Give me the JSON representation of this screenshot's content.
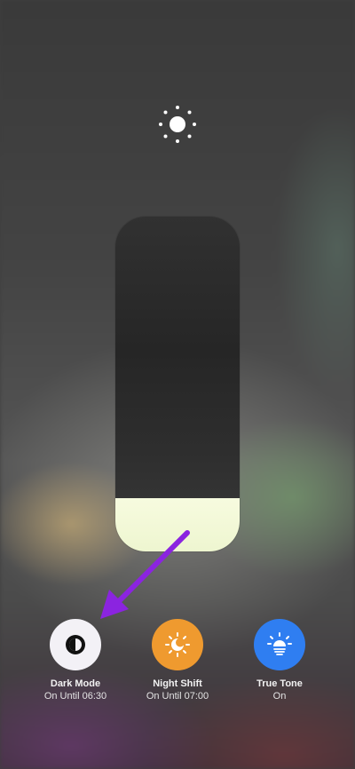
{
  "brightness": {
    "level": 0.16,
    "icon": "sun-icon"
  },
  "controls": [
    {
      "label": "Dark Mode",
      "status": "On Until 06:30",
      "icon": "dark-mode-icon",
      "color": "#f3f1f6"
    },
    {
      "label": "Night Shift",
      "status": "On Until 07:00",
      "icon": "night-shift-icon",
      "color": "#ef9a2f"
    },
    {
      "label": "True Tone",
      "status": "On",
      "icon": "true-tone-icon",
      "color": "#2f7ef1"
    }
  ],
  "annotation": {
    "arrow_color": "#8b24e0",
    "points_to": "Dark Mode"
  }
}
